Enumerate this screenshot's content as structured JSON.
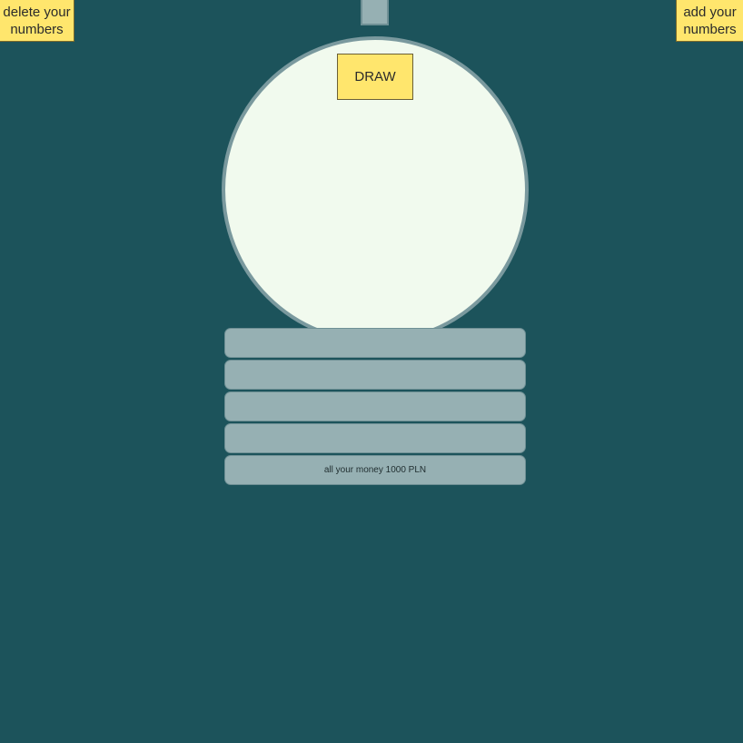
{
  "controls": {
    "delete_label": "delete your\nnumbers",
    "add_label": "add your\nnumbers",
    "draw_label": "DRAW"
  },
  "slots": [
    {
      "text": ""
    },
    {
      "text": ""
    },
    {
      "text": ""
    },
    {
      "text": ""
    },
    {
      "text": "all your money 1000 PLN"
    }
  ],
  "colors": {
    "background": "#1c535b",
    "button": "#ffe66d",
    "globe": "#f1faee",
    "slot": "#96b0b3"
  }
}
